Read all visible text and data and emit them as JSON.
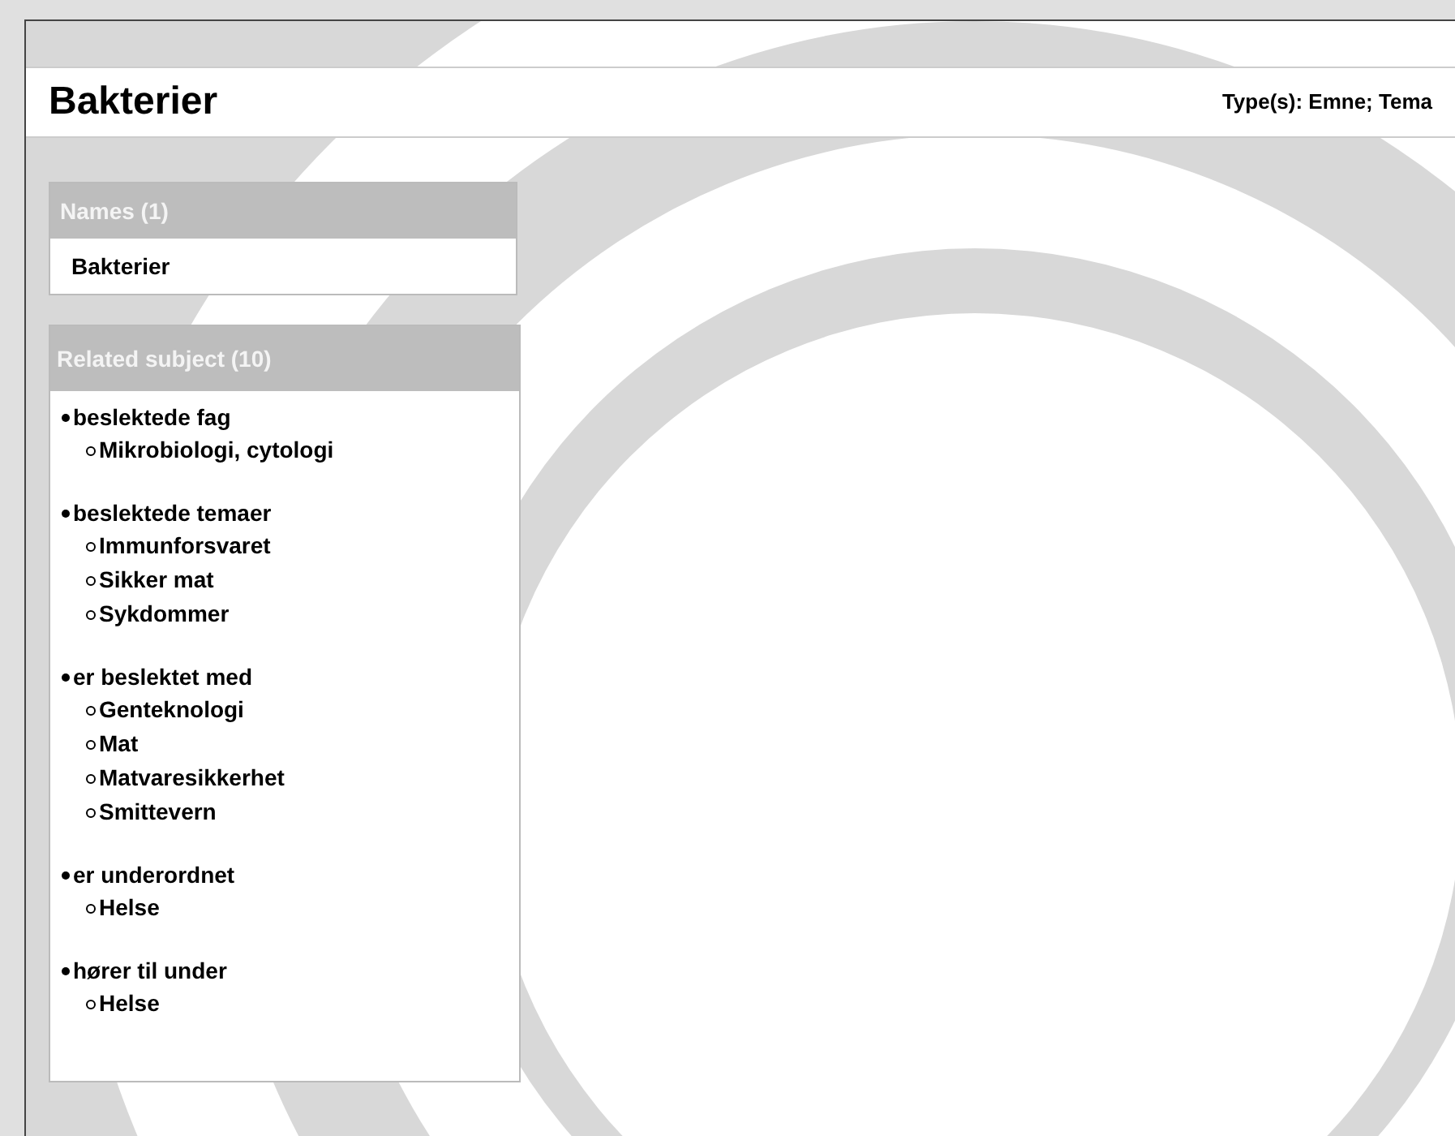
{
  "header": {
    "title": "Bakterier",
    "types": "Type(s): Emne; Tema"
  },
  "names_panel": {
    "title": "Names (1)",
    "items": [
      "Bakterier"
    ]
  },
  "related_panel": {
    "title": "Related subject (10)",
    "groups": [
      {
        "label": "beslektede fag",
        "children": [
          "Mikrobiologi, cytologi"
        ]
      },
      {
        "label": "beslektede temaer",
        "children": [
          "Immunforsvaret",
          "Sikker mat",
          "Sykdommer"
        ]
      },
      {
        "label": "er beslektet med",
        "children": [
          "Genteknologi",
          "Mat",
          "Matvaresikkerhet",
          "Smittevern"
        ]
      },
      {
        "label": "er underordnet",
        "children": [
          "Helse"
        ]
      },
      {
        "label": "hører til under",
        "children": [
          "Helse"
        ]
      }
    ]
  }
}
